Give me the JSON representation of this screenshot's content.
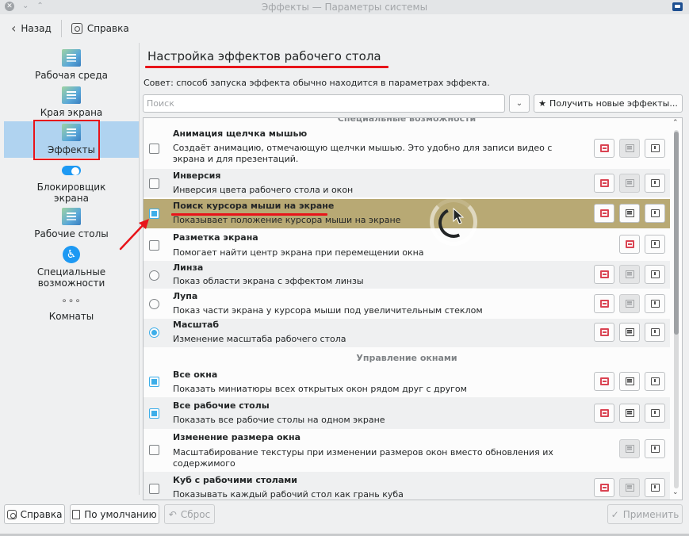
{
  "window": {
    "title": "Эффекты — Параметры системы",
    "close_glyph": "✕",
    "controls": [
      "⌄",
      "⌃"
    ]
  },
  "toolbar": {
    "back_label": "Назад",
    "help_label": "Справка"
  },
  "sidebar": {
    "items": [
      {
        "label": "Рабочая среда",
        "icon": "workspace-icon"
      },
      {
        "label": "Края экрана",
        "icon": "screen-edges-icon"
      },
      {
        "label": "Эффекты",
        "icon": "effects-icon",
        "active": true
      },
      {
        "label": "Блокировщик экрана",
        "icon": "toggle-icon"
      },
      {
        "label": "Рабочие столы",
        "icon": "desktops-icon"
      },
      {
        "label": "Специальные возможности",
        "icon": "accessibility-icon"
      },
      {
        "label": "Комнаты",
        "icon": "dots-icon"
      }
    ]
  },
  "main": {
    "heading": "Настройка эффектов рабочего стола",
    "hint": "Совет: способ запуска эффекта обычно находится в параметрах эффекта.",
    "search_placeholder": "Поиск",
    "get_new_label": "Получить новые эффекты...",
    "dropdown_glyph": "⌄",
    "get_new_glyph": "★"
  },
  "effects": {
    "section_cut": "Специальные возможности",
    "section_windows": "Управление окнами",
    "rows": [
      {
        "title": "Анимация щелчка мышью",
        "desc": "Создаёт анимацию, отмечающую щелчки мышью. Это удобно для записи видео с экрана и для презентаций.",
        "control": "checkbox",
        "checked": false
      },
      {
        "title": "Инверсия",
        "desc": "Инверсия цвета рабочего стола и окон",
        "control": "checkbox",
        "checked": false
      },
      {
        "title": "Поиск курсора мыши на экране",
        "desc": "Показывает положение курсора мыши на экране",
        "control": "checkbox",
        "checked": true,
        "selected": true
      },
      {
        "title": "Разметка экрана",
        "desc": "Помогает найти центр экрана при перемещении окна",
        "control": "checkbox",
        "checked": false
      },
      {
        "title": "Линза",
        "desc": "Показ области экрана с эффектом линзы",
        "control": "radio",
        "checked": false
      },
      {
        "title": "Лупа",
        "desc": "Показ части экрана у курсора мыши под увеличительным стеклом",
        "control": "radio",
        "checked": false
      },
      {
        "title": "Масштаб",
        "desc": "Изменение масштаба рабочего стола",
        "control": "radio",
        "checked": true
      },
      {
        "title": "Все окна",
        "desc": "Показать миниатюры всех открытых окон рядом друг с другом",
        "control": "checkbox",
        "checked": true
      },
      {
        "title": "Все рабочие столы",
        "desc": "Показать все рабочие столы на одном экране",
        "control": "checkbox",
        "checked": true
      },
      {
        "title": "Изменение размера окна",
        "desc": "Масштабирование текстуры при изменении размеров окон вместо обновления их содержимого",
        "control": "checkbox",
        "checked": false
      },
      {
        "title": "Куб с рабочими столами",
        "desc": "Показывать каждый рабочий стол как грань куба",
        "control": "checkbox",
        "checked": false
      }
    ]
  },
  "scroll": {
    "up_glyph": "⌃",
    "down_glyph": "⌄"
  },
  "footer": {
    "help_label": "Справка",
    "defaults_label": "По умолчанию",
    "reset_label": "Сброс",
    "apply_label": "Применить",
    "reset_glyph": "↶",
    "apply_glyph": "✓"
  },
  "colors": {
    "accent": "#3daee9",
    "selection": "#b8a974",
    "annotation_red": "#e8141a",
    "sidebar_active": "#b0d3f0"
  }
}
